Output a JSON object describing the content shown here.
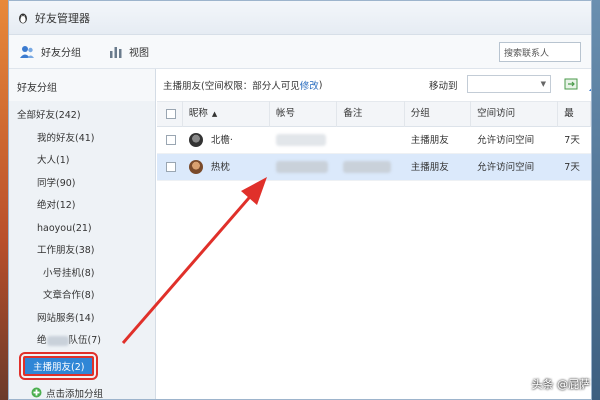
{
  "window": {
    "title": "好友管理器"
  },
  "toolbar": {
    "groups_label": "好友分组",
    "view_label": "视图",
    "search_value": "搜索联系人"
  },
  "sidebar": {
    "header": "好友分组",
    "all_friends": "全部好友(242)",
    "groups": [
      "我的好友(41)",
      "大人(1)",
      "同学(90)",
      "绝对(12)",
      "haoyou(21)",
      "工作朋友(38)",
      "小号挂机(8)",
      "文章合作(8)",
      "网站服务(14)"
    ],
    "partial_group_prefix": "绝",
    "partial_group_suffix": "队伍(7)",
    "selected_group": "主播朋友(2)",
    "add_group": "点击添加分组"
  },
  "main": {
    "group_title": "主播朋友(空间权限：部分人可见",
    "perm_link": "修改",
    "perm_close": ")",
    "move_to": "移动到",
    "columns": [
      "昵称",
      "帐号",
      "备注",
      "分组",
      "空间访问",
      "最"
    ],
    "rows": [
      {
        "nickname": "北檐·",
        "group": "主播朋友",
        "space_access": "允许访问空间",
        "last": "7天"
      },
      {
        "nickname": "热枕",
        "group": "主播朋友",
        "space_access": "允许访问空间",
        "last": "7天"
      }
    ]
  },
  "watermark": "头条 @屁萨",
  "colors": {
    "accent": "#2f86d6",
    "highlight_border": "#e0302a",
    "selected_row": "#dbe9fb"
  }
}
